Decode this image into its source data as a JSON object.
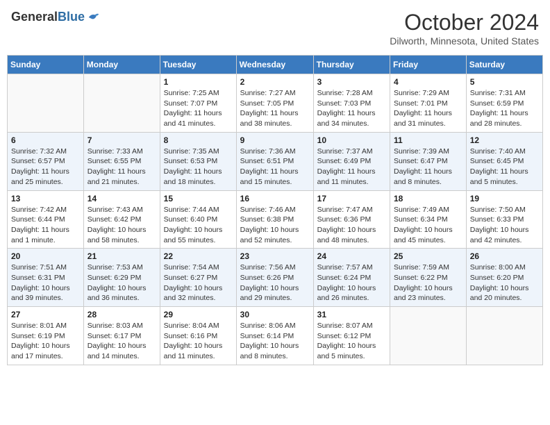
{
  "header": {
    "logo": {
      "general": "General",
      "blue": "Blue"
    },
    "title": "October 2024",
    "location": "Dilworth, Minnesota, United States"
  },
  "weekdays": [
    "Sunday",
    "Monday",
    "Tuesday",
    "Wednesday",
    "Thursday",
    "Friday",
    "Saturday"
  ],
  "weeks": [
    [
      {
        "day": "",
        "info": ""
      },
      {
        "day": "",
        "info": ""
      },
      {
        "day": "1",
        "sunrise": "Sunrise: 7:25 AM",
        "sunset": "Sunset: 7:07 PM",
        "daylight": "Daylight: 11 hours and 41 minutes."
      },
      {
        "day": "2",
        "sunrise": "Sunrise: 7:27 AM",
        "sunset": "Sunset: 7:05 PM",
        "daylight": "Daylight: 11 hours and 38 minutes."
      },
      {
        "day": "3",
        "sunrise": "Sunrise: 7:28 AM",
        "sunset": "Sunset: 7:03 PM",
        "daylight": "Daylight: 11 hours and 34 minutes."
      },
      {
        "day": "4",
        "sunrise": "Sunrise: 7:29 AM",
        "sunset": "Sunset: 7:01 PM",
        "daylight": "Daylight: 11 hours and 31 minutes."
      },
      {
        "day": "5",
        "sunrise": "Sunrise: 7:31 AM",
        "sunset": "Sunset: 6:59 PM",
        "daylight": "Daylight: 11 hours and 28 minutes."
      }
    ],
    [
      {
        "day": "6",
        "sunrise": "Sunrise: 7:32 AM",
        "sunset": "Sunset: 6:57 PM",
        "daylight": "Daylight: 11 hours and 25 minutes."
      },
      {
        "day": "7",
        "sunrise": "Sunrise: 7:33 AM",
        "sunset": "Sunset: 6:55 PM",
        "daylight": "Daylight: 11 hours and 21 minutes."
      },
      {
        "day": "8",
        "sunrise": "Sunrise: 7:35 AM",
        "sunset": "Sunset: 6:53 PM",
        "daylight": "Daylight: 11 hours and 18 minutes."
      },
      {
        "day": "9",
        "sunrise": "Sunrise: 7:36 AM",
        "sunset": "Sunset: 6:51 PM",
        "daylight": "Daylight: 11 hours and 15 minutes."
      },
      {
        "day": "10",
        "sunrise": "Sunrise: 7:37 AM",
        "sunset": "Sunset: 6:49 PM",
        "daylight": "Daylight: 11 hours and 11 minutes."
      },
      {
        "day": "11",
        "sunrise": "Sunrise: 7:39 AM",
        "sunset": "Sunset: 6:47 PM",
        "daylight": "Daylight: 11 hours and 8 minutes."
      },
      {
        "day": "12",
        "sunrise": "Sunrise: 7:40 AM",
        "sunset": "Sunset: 6:45 PM",
        "daylight": "Daylight: 11 hours and 5 minutes."
      }
    ],
    [
      {
        "day": "13",
        "sunrise": "Sunrise: 7:42 AM",
        "sunset": "Sunset: 6:44 PM",
        "daylight": "Daylight: 11 hours and 1 minute."
      },
      {
        "day": "14",
        "sunrise": "Sunrise: 7:43 AM",
        "sunset": "Sunset: 6:42 PM",
        "daylight": "Daylight: 10 hours and 58 minutes."
      },
      {
        "day": "15",
        "sunrise": "Sunrise: 7:44 AM",
        "sunset": "Sunset: 6:40 PM",
        "daylight": "Daylight: 10 hours and 55 minutes."
      },
      {
        "day": "16",
        "sunrise": "Sunrise: 7:46 AM",
        "sunset": "Sunset: 6:38 PM",
        "daylight": "Daylight: 10 hours and 52 minutes."
      },
      {
        "day": "17",
        "sunrise": "Sunrise: 7:47 AM",
        "sunset": "Sunset: 6:36 PM",
        "daylight": "Daylight: 10 hours and 48 minutes."
      },
      {
        "day": "18",
        "sunrise": "Sunrise: 7:49 AM",
        "sunset": "Sunset: 6:34 PM",
        "daylight": "Daylight: 10 hours and 45 minutes."
      },
      {
        "day": "19",
        "sunrise": "Sunrise: 7:50 AM",
        "sunset": "Sunset: 6:33 PM",
        "daylight": "Daylight: 10 hours and 42 minutes."
      }
    ],
    [
      {
        "day": "20",
        "sunrise": "Sunrise: 7:51 AM",
        "sunset": "Sunset: 6:31 PM",
        "daylight": "Daylight: 10 hours and 39 minutes."
      },
      {
        "day": "21",
        "sunrise": "Sunrise: 7:53 AM",
        "sunset": "Sunset: 6:29 PM",
        "daylight": "Daylight: 10 hours and 36 minutes."
      },
      {
        "day": "22",
        "sunrise": "Sunrise: 7:54 AM",
        "sunset": "Sunset: 6:27 PM",
        "daylight": "Daylight: 10 hours and 32 minutes."
      },
      {
        "day": "23",
        "sunrise": "Sunrise: 7:56 AM",
        "sunset": "Sunset: 6:26 PM",
        "daylight": "Daylight: 10 hours and 29 minutes."
      },
      {
        "day": "24",
        "sunrise": "Sunrise: 7:57 AM",
        "sunset": "Sunset: 6:24 PM",
        "daylight": "Daylight: 10 hours and 26 minutes."
      },
      {
        "day": "25",
        "sunrise": "Sunrise: 7:59 AM",
        "sunset": "Sunset: 6:22 PM",
        "daylight": "Daylight: 10 hours and 23 minutes."
      },
      {
        "day": "26",
        "sunrise": "Sunrise: 8:00 AM",
        "sunset": "Sunset: 6:20 PM",
        "daylight": "Daylight: 10 hours and 20 minutes."
      }
    ],
    [
      {
        "day": "27",
        "sunrise": "Sunrise: 8:01 AM",
        "sunset": "Sunset: 6:19 PM",
        "daylight": "Daylight: 10 hours and 17 minutes."
      },
      {
        "day": "28",
        "sunrise": "Sunrise: 8:03 AM",
        "sunset": "Sunset: 6:17 PM",
        "daylight": "Daylight: 10 hours and 14 minutes."
      },
      {
        "day": "29",
        "sunrise": "Sunrise: 8:04 AM",
        "sunset": "Sunset: 6:16 PM",
        "daylight": "Daylight: 10 hours and 11 minutes."
      },
      {
        "day": "30",
        "sunrise": "Sunrise: 8:06 AM",
        "sunset": "Sunset: 6:14 PM",
        "daylight": "Daylight: 10 hours and 8 minutes."
      },
      {
        "day": "31",
        "sunrise": "Sunrise: 8:07 AM",
        "sunset": "Sunset: 6:12 PM",
        "daylight": "Daylight: 10 hours and 5 minutes."
      },
      {
        "day": "",
        "info": ""
      },
      {
        "day": "",
        "info": ""
      }
    ]
  ]
}
